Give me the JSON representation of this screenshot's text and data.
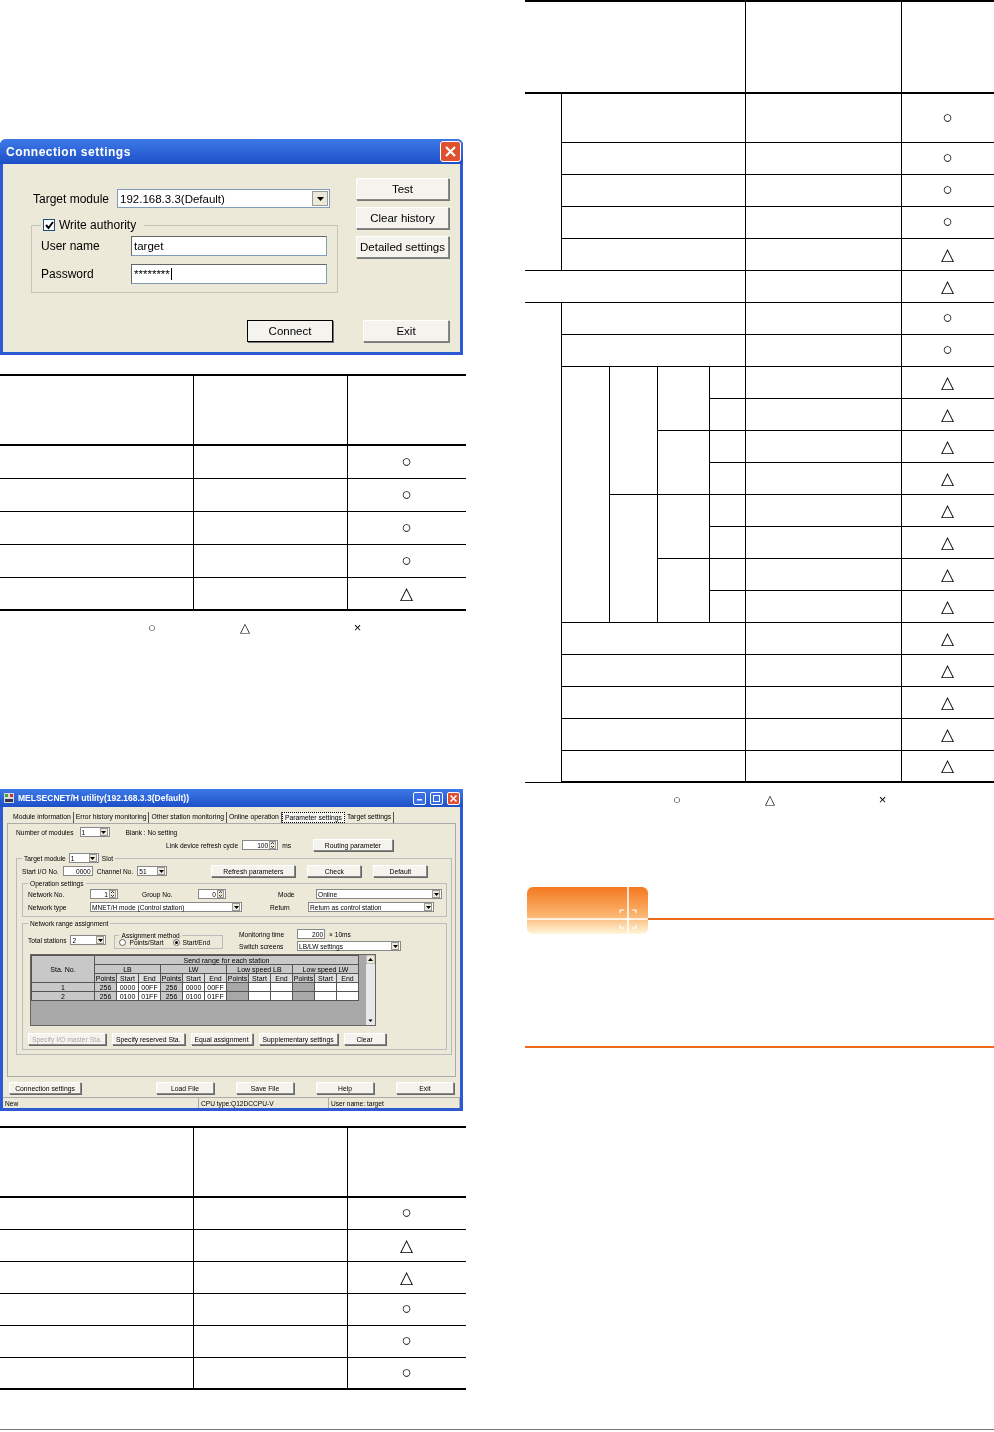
{
  "connection_dialog": {
    "title": "Connection settings",
    "target_module": {
      "label": "Target module",
      "value": "192.168.3.3(Default)"
    },
    "write_authority": {
      "label": "Write authority",
      "checked": true
    },
    "user_name": {
      "label": "User name",
      "value": "target"
    },
    "password": {
      "label": "Password",
      "value": "********"
    },
    "side_buttons": [
      "Test",
      "Clear history",
      "Detailed settings"
    ],
    "bottom_buttons": [
      {
        "label": "Connect",
        "focused": true
      },
      {
        "label": "Exit",
        "focused": false
      }
    ]
  },
  "table_1": {
    "rows": [
      {
        "column_3": "○"
      },
      {
        "column_3": "○"
      },
      {
        "column_3": "○"
      },
      {
        "column_3": "○"
      },
      {
        "column_3": "△"
      }
    ]
  },
  "legend_1": [
    "○",
    "△",
    "×"
  ],
  "utility_window": {
    "title": "MELSECNET/H utility(192.168.3.3(Default))",
    "tabs": [
      {
        "label": "Module information",
        "selected": false
      },
      {
        "label": "Error history monitoring",
        "selected": false
      },
      {
        "label": "Other station monitoring",
        "selected": false
      },
      {
        "label": "Online operation",
        "selected": false
      },
      {
        "label": "Parameter settings",
        "selected": true
      },
      {
        "label": "Target settings",
        "selected": false
      }
    ],
    "number_of_modules": {
      "label": "Number of modules",
      "value": "1"
    },
    "blank_note": "Blank : No setting",
    "refresh_cycle": {
      "label": "Link device refresh cycle",
      "value": "100",
      "unit": "ms"
    },
    "routing_button": "Routing parameter",
    "target_module": {
      "label": "Target module",
      "value": "1",
      "suffix": "Slot"
    },
    "start_io": {
      "label": "Start I/O No.",
      "value": "0000"
    },
    "channel": {
      "label": "Channel No.",
      "value": "51"
    },
    "action_buttons": [
      "Refresh parameters",
      "Check",
      "Default"
    ],
    "operation_settings": {
      "label": "Operation settings",
      "network_no": {
        "label": "Network No.",
        "value": "1"
      },
      "group_no": {
        "label": "Group No.",
        "value": "0"
      },
      "mode": {
        "label": "Mode",
        "value": "Online"
      },
      "network_type": {
        "label": "Network type",
        "value": "MNET/H mode (Control station)"
      },
      "return": {
        "label": "Return",
        "value": "Return as control station"
      }
    },
    "range_assignment": {
      "label": "Network range assignment",
      "total_stations": {
        "label": "Total stations",
        "value": "2"
      },
      "assignment_method": {
        "label": "Assignment method",
        "options": [
          {
            "label": "Points/Start",
            "selected": false
          },
          {
            "label": "Start/End",
            "selected": true
          }
        ]
      },
      "monitoring_time": {
        "label": "Monitoring time",
        "value": "200",
        "unit": "× 10ms"
      },
      "switch_screens": {
        "label": "Switch screens",
        "value": "LB/LW settings"
      },
      "grid": {
        "corner": "Sta. No.",
        "group_header": "Send range for each station",
        "groups": [
          "LB",
          "LW",
          "Low speed LB",
          "Low speed LW"
        ],
        "subcolumns": [
          "Points",
          "Start",
          "End",
          "Points",
          "Start",
          "End",
          "Points",
          "Start",
          "End",
          "Points",
          "Start",
          "End"
        ],
        "rows": [
          {
            "sta": "1",
            "cells": [
              "256",
              "0000",
              "00FF",
              "256",
              "0000",
              "00FF"
            ]
          },
          {
            "sta": "2",
            "cells": [
              "256",
              "0100",
              "01FF",
              "256",
              "0100",
              "01FF"
            ]
          }
        ]
      },
      "buttons": [
        {
          "label": "Specify I/O master Sta.",
          "disabled": true
        },
        {
          "label": "Specify reserved Sta.",
          "disabled": false
        },
        {
          "label": "Equal assignment",
          "disabled": false
        },
        {
          "label": "Supplementary settings",
          "disabled": false
        },
        {
          "label": "Clear",
          "disabled": false
        }
      ]
    },
    "footer_buttons": [
      "Connection settings",
      "Load File",
      "Save File",
      "Help",
      "Exit"
    ],
    "status_bar": [
      "New",
      "CPU type:Q12DCCPU-V",
      "User name: target"
    ]
  },
  "table_2": {
    "rows": [
      {
        "column_3": "○"
      },
      {
        "column_3": "△"
      },
      {
        "column_3": "△"
      },
      {
        "column_3": "○"
      },
      {
        "column_3": "○"
      },
      {
        "column_3": "○"
      }
    ]
  },
  "table_3": {
    "rows": [
      {
        "column_3": "○"
      },
      {
        "column_3": "○"
      },
      {
        "column_3": "○"
      },
      {
        "column_3": "○"
      },
      {
        "column_3": "△"
      },
      {
        "column_3": "△"
      },
      {
        "column_3": "○"
      },
      {
        "column_3": "○"
      },
      {
        "column_3": "△"
      },
      {
        "column_3": "△"
      },
      {
        "column_3": "△"
      },
      {
        "column_3": "△"
      },
      {
        "column_3": "△"
      },
      {
        "column_3": "△"
      },
      {
        "column_3": "△"
      },
      {
        "column_3": "△"
      },
      {
        "column_3": "△"
      },
      {
        "column_3": "△"
      },
      {
        "column_3": "△"
      },
      {
        "column_3": "△"
      },
      {
        "column_3": "△"
      }
    ]
  },
  "legend_2": [
    "○",
    "△",
    "×"
  ]
}
